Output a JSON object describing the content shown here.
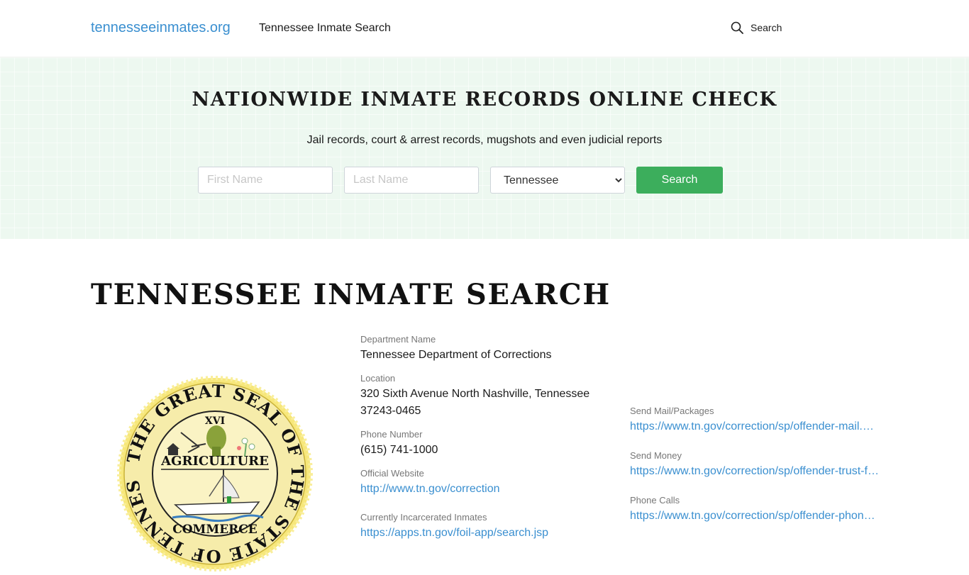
{
  "header": {
    "logo": "tennesseeinmates.org",
    "nav_link": "Tennessee Inmate Search",
    "search_label": "Search"
  },
  "hero": {
    "title": "NATIONWIDE INMATE RECORDS ONLINE CHECK",
    "subtitle": "Jail records, court & arrest records, mugshots and even judicial reports",
    "first_name_placeholder": "First Name",
    "last_name_placeholder": "Last Name",
    "state_selected": "Tennessee",
    "search_button": "Search"
  },
  "main": {
    "title": "TENNESSEE INMATE SEARCH",
    "seal": {
      "ring_text": "THE GREAT SEAL OF THE STATE OF TENNESSEE",
      "number": "XVI",
      "top_word": "AGRICULTURE",
      "bottom_word": "COMMERCE"
    },
    "details": [
      {
        "label": "Department Name",
        "value": "Tennessee Department of Corrections"
      },
      {
        "label": "Location",
        "value": "320 Sixth Avenue North Nashville, Tennessee 37243-0465"
      },
      {
        "label": "Phone Number",
        "value": "(615) 741-1000"
      },
      {
        "label": "Official Website",
        "link": "http://www.tn.gov/correction"
      },
      {
        "label": "Currently Incarcerated Inmates",
        "link": "https://apps.tn.gov/foil-app/search.jsp"
      }
    ],
    "services": [
      {
        "label": "Send Mail/Packages",
        "link": "https://www.tn.gov/correction/sp/offender-mail.html"
      },
      {
        "label": "Send Money",
        "link": "https://www.tn.gov/correction/sp/offender-trust-fund.html"
      },
      {
        "label": "Phone Calls",
        "link": "https://www.tn.gov/correction/sp/offender-phone-calls.html"
      }
    ]
  },
  "colors": {
    "accent_link": "#3a8fd0",
    "button_green": "#3cae5c",
    "hero_bg": "#edf8f0",
    "seal_gold": "#f2e27a"
  },
  "icons": [
    "search-icon"
  ]
}
